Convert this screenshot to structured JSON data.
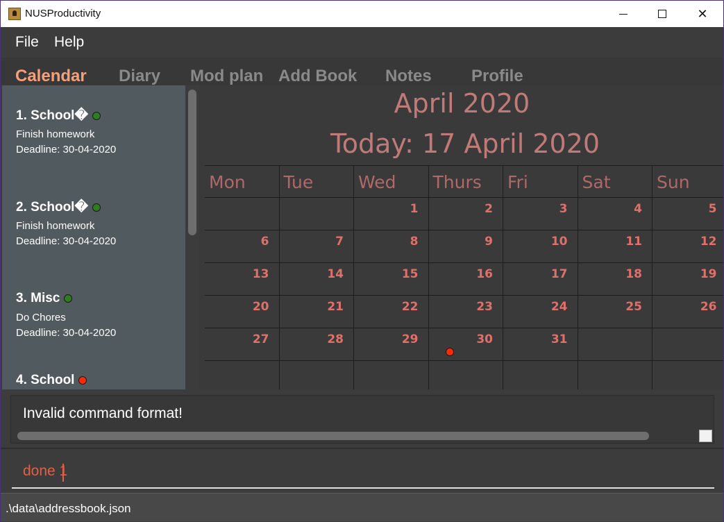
{
  "window": {
    "title": "NUSProductivity"
  },
  "menu": {
    "file": "File",
    "help": "Help"
  },
  "tabs": [
    {
      "label": "Calendar",
      "active": true
    },
    {
      "label": "Diary",
      "active": false
    },
    {
      "label": "Mod plan",
      "active": false
    },
    {
      "label": "Add Book",
      "active": false
    },
    {
      "label": "Notes",
      "active": false
    },
    {
      "label": "Profile",
      "active": false
    }
  ],
  "tasks": [
    {
      "title": "1.  School�",
      "description": "Finish homework",
      "deadline": "Deadline: 30-04-2020",
      "status_color": "#2e7d1e"
    },
    {
      "title": "2.  School�",
      "description": "Finish homework",
      "deadline": "Deadline: 30-04-2020",
      "status_color": "#2e7d1e"
    },
    {
      "title": "3.  Misc",
      "description": "Do Chores",
      "deadline": "Deadline: 30-04-2020",
      "status_color": "#2e7d1e"
    },
    {
      "title": "4.  School",
      "description": "",
      "deadline": "",
      "status_color": "#ff2a00"
    }
  ],
  "calendar": {
    "month": "April 2020",
    "today": "Today: 17 April 2020",
    "weekdays": [
      "Mon",
      "Tue",
      "Wed",
      "Thurs",
      "Fri",
      "Sat",
      "Sun"
    ],
    "weeks": [
      [
        "",
        "",
        "1",
        "2",
        "3",
        "4",
        "5"
      ],
      [
        "6",
        "7",
        "8",
        "9",
        "10",
        "11",
        "12"
      ],
      [
        "13",
        "14",
        "15",
        "16",
        "17",
        "18",
        "19"
      ],
      [
        "20",
        "21",
        "22",
        "23",
        "24",
        "25",
        "26"
      ],
      [
        "27",
        "28",
        "29",
        "30",
        "31",
        "",
        ""
      ],
      [
        "",
        "",
        "",
        "",
        "",
        "",
        ""
      ]
    ],
    "event_days": [
      "30"
    ],
    "event_color": "#ff2a00"
  },
  "result": {
    "message": "Invalid command format!"
  },
  "command": {
    "value": "done 1"
  },
  "status": {
    "path": ".\\data\\addressbook.json"
  }
}
